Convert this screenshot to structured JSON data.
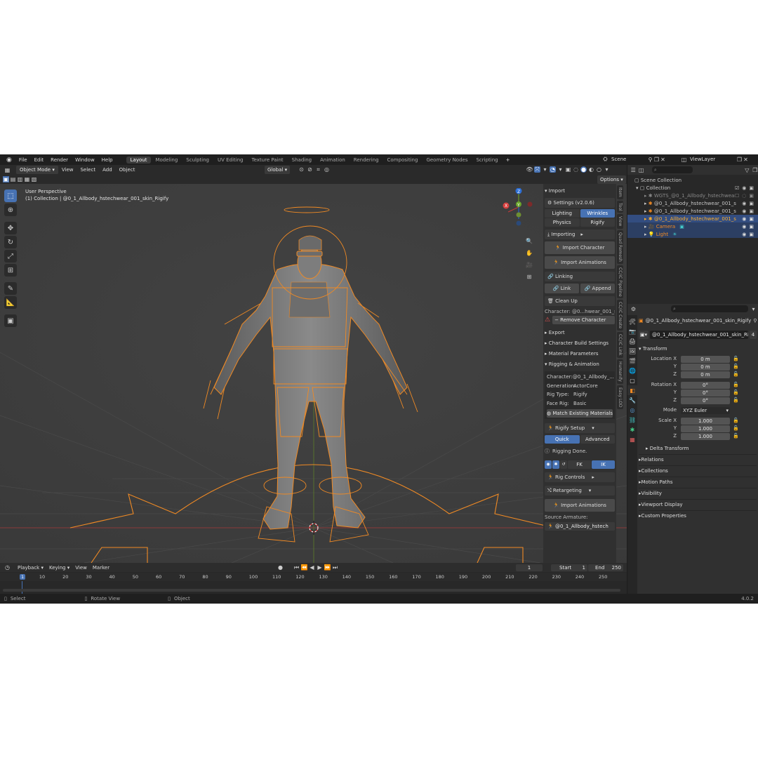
{
  "menus": [
    "File",
    "Edit",
    "Render",
    "Window",
    "Help"
  ],
  "workspaces": [
    "Layout",
    "Modeling",
    "Sculpting",
    "UV Editing",
    "Texture Paint",
    "Shading",
    "Animation",
    "Rendering",
    "Compositing",
    "Geometry Nodes",
    "Scripting"
  ],
  "scene": "Scene",
  "view_layer": "ViewLayer",
  "viewport": {
    "mode": "Object Mode",
    "menu": [
      "View",
      "Select",
      "Add",
      "Object"
    ],
    "orientation": "Global",
    "options_label": "Options",
    "overlay_title": "User Perspective",
    "overlay_subtitle": "(1) Collection | @0_1_Allbody_hstechwear_001_skin_Rigify"
  },
  "npanel": {
    "import_label": "Import",
    "settings_label": "Settings  (v2.0.6)",
    "tabs_row1": [
      "Lighting",
      "Wrinkles"
    ],
    "tabs_row2": [
      "Physics",
      "Rigify"
    ],
    "importing_label": "Importing",
    "import_character": "Import Character",
    "import_animations": "Import Animations",
    "linking_label": "Linking",
    "link": "Link",
    "append": "Append",
    "clean_up": "Clean Up",
    "character_line": "Character: @0...hwear_001_skin",
    "remove_character": "Remove Character",
    "export": "Export",
    "char_build": "Character Build Settings",
    "material_params": "Material Parameters",
    "rigging_animation": "Rigging & Animation",
    "info_labels": [
      "Character:",
      "Generation:",
      "Rig Type:",
      "Face Rig:"
    ],
    "info_values": [
      "@0_1_Allbody_...",
      "ActorCore",
      "Rigify",
      "Basic"
    ],
    "match_materials": "Match Existing Materials",
    "rigify_setup": "Rigify Setup",
    "quick": "Quick",
    "advanced": "Advanced",
    "rigging_done": "Rigging Done.",
    "fk": "FK",
    "ik": "IK",
    "rig_controls": "Rig Controls",
    "retargeting": "Retargeting",
    "import_animations2": "Import Animations",
    "source_armature": "Source Armature:",
    "source_value": "@0_1_Allbody_hstech"
  },
  "side_tabs": [
    "Item",
    "Tool",
    "View",
    "Quad Remesh",
    "CC/iC Pipeline",
    "CC/iC Create",
    "CC/iC Link",
    "Humanify",
    "Easy LOD"
  ],
  "outliner": {
    "scene_collection": "Scene Collection",
    "collection": "Collection",
    "items": [
      "WGTS_@0_1_Allbody_hstechwear",
      "@0_1_Allbody_hstechwear_001_s",
      "@0_1_Allbody_hstechwear_001_s",
      "@0_1_Allbody_hstechwear_001_s",
      "Camera",
      "Light"
    ]
  },
  "properties": {
    "object_name": "@0_1_Allbody_hstechwear_001_skin_Rigify",
    "data_name": "@0_1_Allbody_hstechwear_001_skin_Ri...",
    "users": "4",
    "transform": "Transform",
    "location_label": "Location X",
    "location": [
      "0 m",
      "0 m",
      "0 m"
    ],
    "rotation_label": "Rotation X",
    "rotation": [
      "0°",
      "0°",
      "0°"
    ],
    "mode_label": "Mode",
    "mode_value": "XYZ Euler",
    "scale_label": "Scale X",
    "scale": [
      "1.000",
      "1.000",
      "1.000"
    ],
    "axis_labels": [
      "Y",
      "Z"
    ],
    "delta": "Delta Transform",
    "sections": [
      "Relations",
      "Collections",
      "Motion Paths",
      "Visibility",
      "Viewport Display",
      "Custom Properties"
    ]
  },
  "timeline": {
    "menu": [
      "Playback",
      "Keying",
      "View",
      "Marker"
    ],
    "current_frame": "1",
    "start_label": "Start",
    "start": "1",
    "end_label": "End",
    "end": "250",
    "ticks": [
      "1",
      "10",
      "20",
      "30",
      "40",
      "50",
      "60",
      "70",
      "80",
      "90",
      "100",
      "110",
      "120",
      "130",
      "140",
      "150",
      "160",
      "170",
      "180",
      "190",
      "200",
      "210",
      "220",
      "230",
      "240",
      "250"
    ]
  },
  "statusbar": {
    "select": "Select",
    "rotate": "Rotate View",
    "object": "Object",
    "version": "4.0.2"
  },
  "colors": {
    "accent": "#4772b3",
    "select_orange": "#f08a24",
    "bg": "#1d1d1d",
    "viewport": "#3d3d3d"
  }
}
